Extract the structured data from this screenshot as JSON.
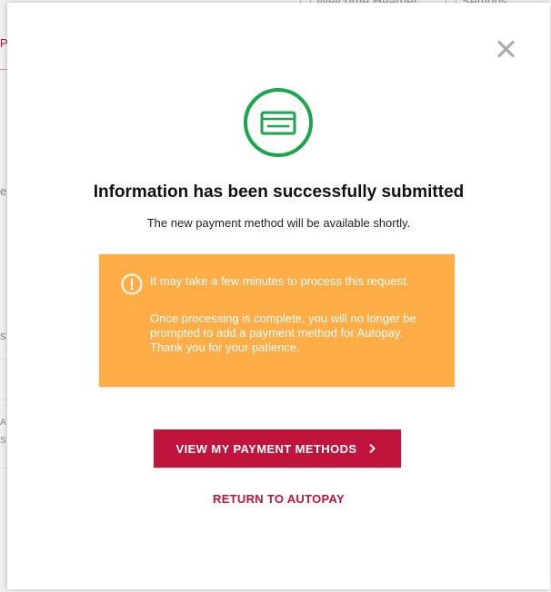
{
  "background": {
    "welcome_text": "Welcome Heather",
    "settings_text": "Settings",
    "left_fragments": [
      "P",
      "e",
      "s",
      "A",
      "S"
    ]
  },
  "modal": {
    "close_icon": "close-icon",
    "success_icon": "credit-card-check-icon",
    "title": "Information has been successfully submitted",
    "subtitle": "The new payment method will be available shortly.",
    "notice": {
      "icon": "info-icon",
      "line1": "It may take a few minutes to process this request.",
      "line2": "Once processing is complete, you will no longer be prompted to add a payment method for Autopay. Thank you for your patience."
    },
    "primary_button": "VIEW MY PAYMENT METHODS",
    "secondary_link": "RETURN TO AUTOPAY"
  },
  "colors": {
    "accent": "#c0143c",
    "success_green": "#1aa64a",
    "notice_orange": "#ffad47"
  }
}
